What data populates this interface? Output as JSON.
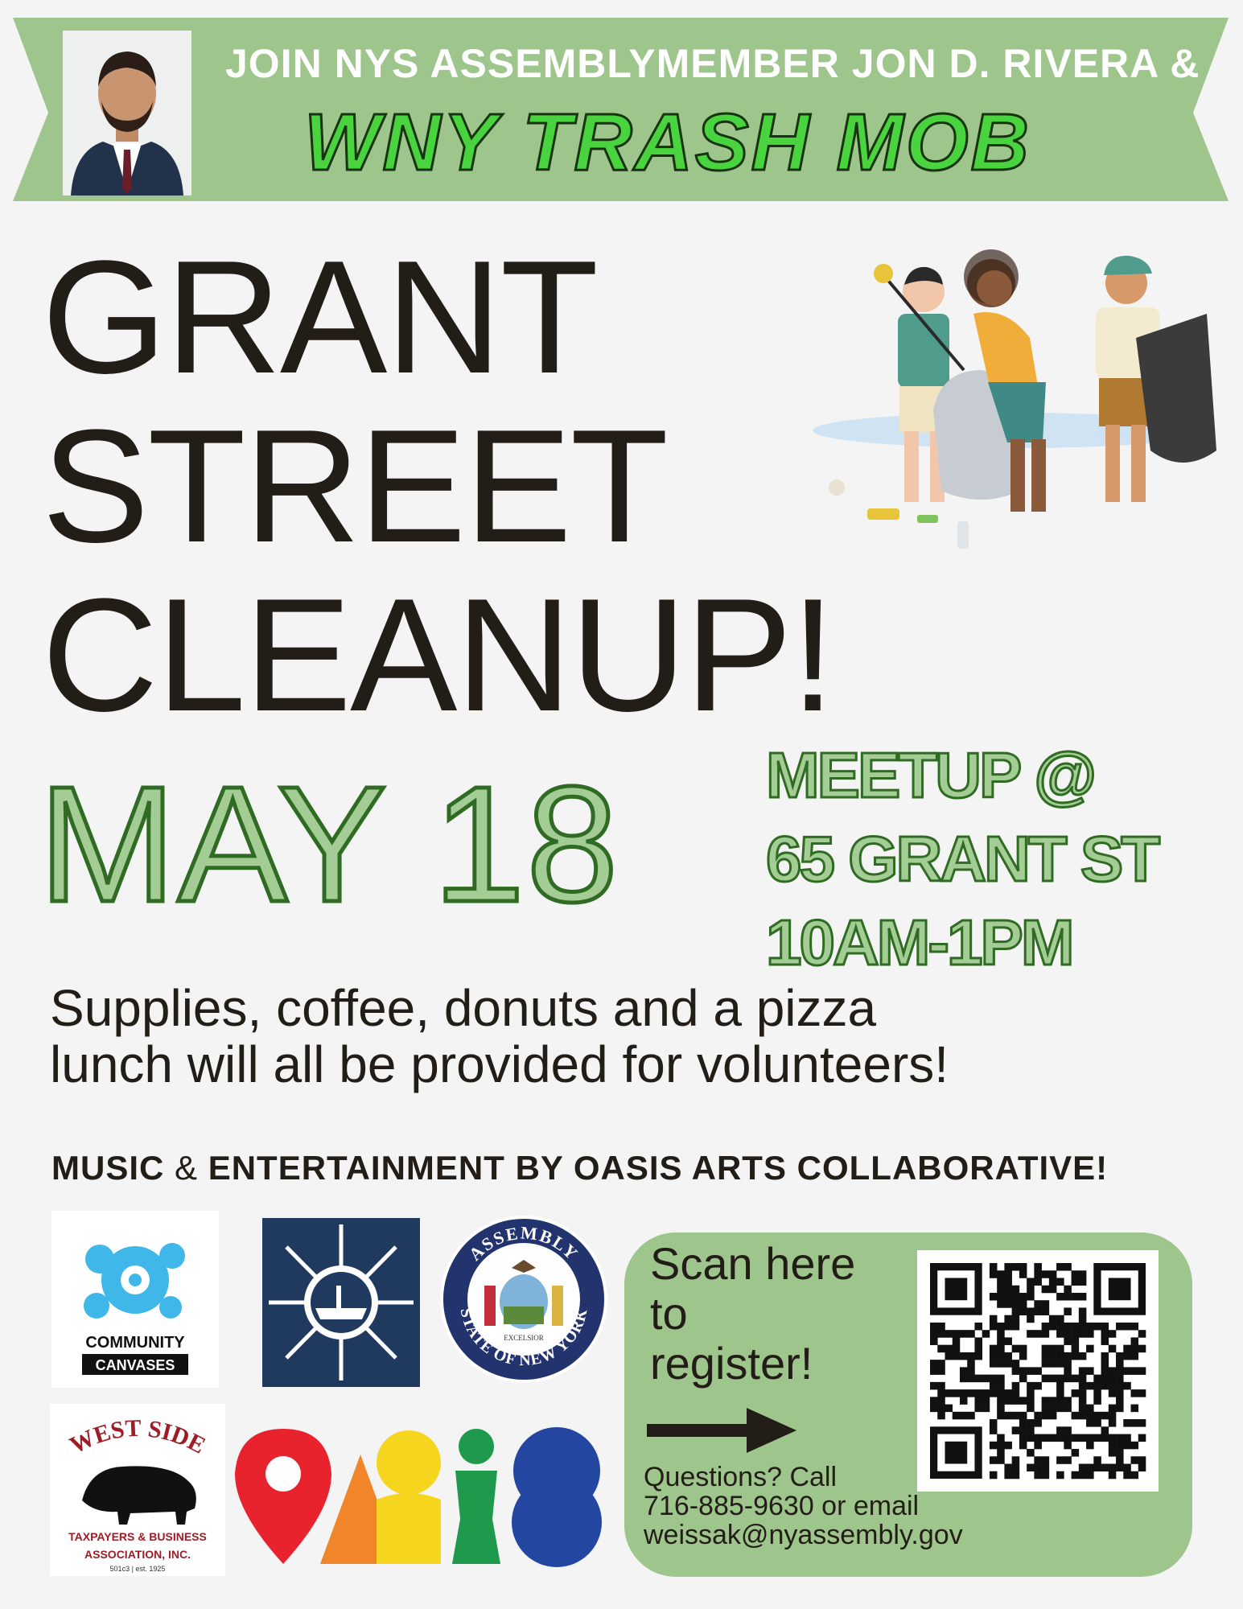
{
  "banner": {
    "line1": "JOIN NYS ASSEMBLYMEMBER JON D. RIVERA &",
    "line2": "WNY TRASH MOB",
    "color": "#9ec58c"
  },
  "title": {
    "lines": [
      "GRANT",
      "STREET",
      "CLEANUP!"
    ]
  },
  "date": "MAY 18",
  "meetup": {
    "lines": [
      "MEETUP @",
      "65 GRANT ST",
      "10AM-1PM"
    ]
  },
  "supplies": {
    "lines": [
      "Supplies, coffee, donuts and a pizza",
      "lunch will all be provided for volunteers!"
    ]
  },
  "music": {
    "part1": "MUSIC",
    "amp": " & ",
    "part2": "ENTERTAINMENT BY OASIS ARTS COLLABORATIVE!"
  },
  "logos": {
    "community_canvases": [
      "COMMUNITY",
      "CANVASES"
    ],
    "seal": {
      "top": "ASSEMBLY",
      "bottom": "STATE OF NEW YORK",
      "motto": "EXCELSIOR"
    },
    "west_side": {
      "title": "WEST SIDE",
      "line1": "TAXPAYERS & BUSINESS",
      "line2": "ASSOCIATION, INC.",
      "line3": "501c3 | est. 1925"
    }
  },
  "register": {
    "scan_lines": [
      "Scan here",
      "to",
      "register!"
    ],
    "questions_lines": [
      "Questions? Call",
      "716-885-9630 or email",
      "weissak@nyassembly.gov"
    ]
  },
  "icons": {
    "arrow": "arrow-right-icon",
    "qr": "qr-code-icon"
  }
}
